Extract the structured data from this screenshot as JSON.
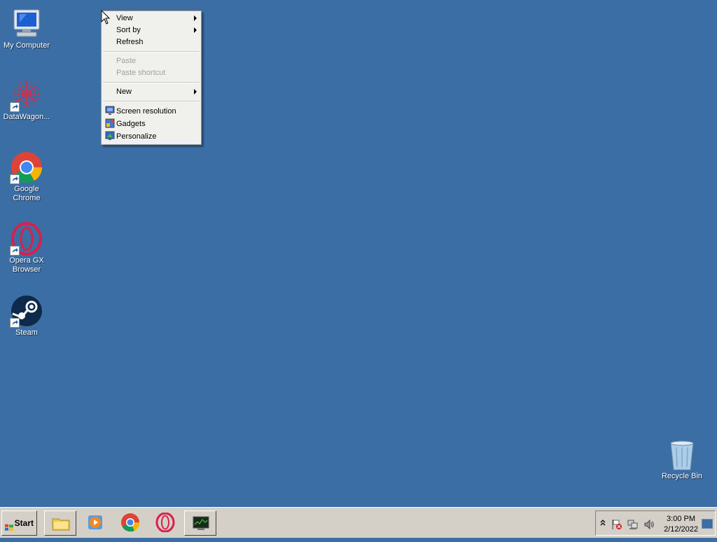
{
  "desktop": {
    "icons": [
      {
        "label": "My Computer"
      },
      {
        "label": "DataWagon..."
      },
      {
        "label": "Google Chrome"
      },
      {
        "label": "Opera GX Browser"
      },
      {
        "label": "Steam"
      },
      {
        "label": "Recycle Bin"
      }
    ]
  },
  "context_menu": {
    "items": [
      {
        "label": "View",
        "submenu": true,
        "enabled": true
      },
      {
        "label": "Sort by",
        "submenu": true,
        "enabled": true
      },
      {
        "label": "Refresh",
        "enabled": true
      },
      {
        "label": "Paste",
        "enabled": false
      },
      {
        "label": "Paste shortcut",
        "enabled": false
      },
      {
        "label": "New",
        "submenu": true,
        "enabled": true
      },
      {
        "label": "Screen resolution",
        "icon": "screen-resolution-icon",
        "enabled": true
      },
      {
        "label": "Gadgets",
        "icon": "gadgets-icon",
        "enabled": true
      },
      {
        "label": "Personalize",
        "icon": "personalize-icon",
        "enabled": true
      }
    ]
  },
  "taskbar": {
    "start_label": "Start",
    "pinned": [
      {
        "icon": "file-explorer-icon"
      },
      {
        "icon": "media-player-icon"
      },
      {
        "icon": "chrome-icon"
      },
      {
        "icon": "opera-gx-icon"
      },
      {
        "icon": "network-monitor-icon"
      }
    ],
    "tray": {
      "icons": [
        "show-hidden-icons-icon",
        "action-center-flag-icon",
        "network-icon",
        "volume-icon"
      ],
      "time": "3:00 PM",
      "date": "2/12/2022"
    }
  },
  "colors": {
    "desktop_bg": "#3b6ea5",
    "taskbar_bg": "#d4d0c8",
    "menu_bg": "#f0f0ec"
  }
}
